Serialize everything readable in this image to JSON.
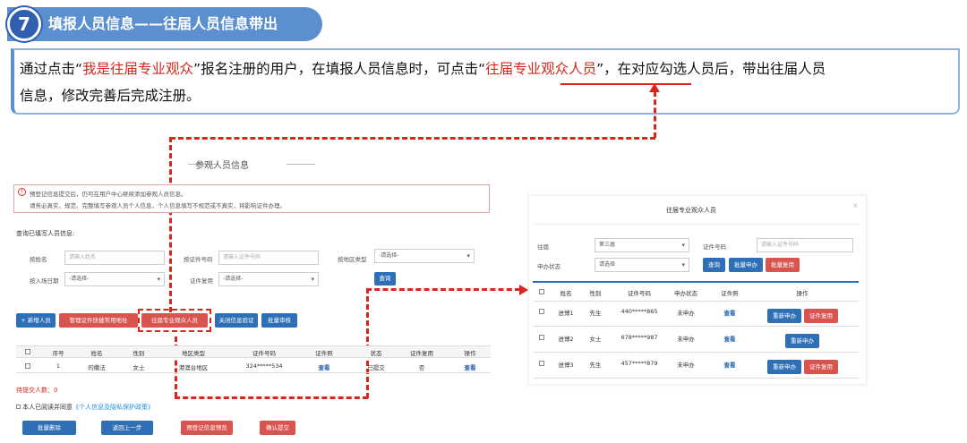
{
  "step": {
    "number": "7",
    "title": "填报人员信息——往届人员信息带出"
  },
  "intro": {
    "p1": "通过点击“",
    "p1_red": "我是往届专业观众",
    "p2": "”报名注册的用户，在填报人员信息时，可点击“",
    "p2_red": "往届专业观众人员",
    "p3": "”，在对应勾选人员后，带出往届人员",
    "p4": "信息，修改完善后完成注册。"
  },
  "left": {
    "title": "参观人员信息",
    "notice_1": "预登记信息提交后，仍可在用户中心继续添加参观人员信息。",
    "notice_2": "请务必真实、规范、完整填写参观人员个人信息，个人信息填写不规范或不真实，将影响证件办理。",
    "query_label": "查询已填写人员信息:",
    "name_label": "按姓名",
    "name_placeholder": "请输入姓名",
    "cert_label": "按证件号码",
    "cert_placeholder": "请输入证件号码",
    "region_label": "按地区类型",
    "region_value": "-请选择-",
    "date_label": "按入场日期",
    "date_value": "-请选择-",
    "reuse_label": "证件复用",
    "reuse_value": "-请选择-",
    "search_btn": "查询",
    "btn_add": "+ 新增人员",
    "btn_manage": "管理证件快捷常用地址",
    "btn_past": "往届专业观众人员",
    "btn_close_verify": "关闭信息验证",
    "btn_batch_review": "批量审核",
    "columns": [
      "序号",
      "姓名",
      "性别",
      "地区类型",
      "证件号码",
      "证件照",
      "状态",
      "证件复用",
      "操作"
    ],
    "row": {
      "seq": "1",
      "name": "的撒法",
      "gender": "女士",
      "region": "港澳台地区",
      "cert": "324*****534",
      "photo": "查看",
      "status": "已提交",
      "reuse": "否",
      "op": "查看"
    },
    "pending": "待提交人数：0",
    "agree_prefix": "本人已阅读并同意",
    "agree_link": "《个人信息及隐私保护政策》",
    "btn_batch_delete": "批量删除",
    "btn_back": "返回上一步",
    "btn_preview": "预登记信息预览",
    "btn_submit": "确认提交"
  },
  "modal": {
    "title": "往届专业观众人员",
    "close": "×",
    "session_label": "往届",
    "session_value": "第三届",
    "cert_label": "证件号码",
    "cert_placeholder": "请输入证件号码",
    "status_label": "申办状态",
    "status_value": "请选择",
    "search_btn": "查询",
    "batch_apply_btn": "批量申办",
    "batch_reuse_btn": "批量复用",
    "columns": [
      "姓名",
      "性别",
      "证件号码",
      "申办状态",
      "证件照",
      "操作"
    ],
    "rows": [
      {
        "name": "进博1",
        "gender": "先生",
        "cert": "440*****865",
        "status": "未申办",
        "photo": "查看",
        "op1": "重新申办",
        "op2": "证件复用"
      },
      {
        "name": "进博2",
        "gender": "女士",
        "cert": "678*****987",
        "status": "未申办",
        "photo": "查看",
        "op1": "重新申办",
        "op2": ""
      },
      {
        "name": "进博3",
        "gender": "先生",
        "cert": "457*****879",
        "status": "未申办",
        "photo": "查看",
        "op1": "重新申办",
        "op2": "证件复用"
      }
    ]
  },
  "colors": {
    "accent": "#2f6fb5",
    "highlight": "#d9261c",
    "banner": "#5b8fd0"
  }
}
